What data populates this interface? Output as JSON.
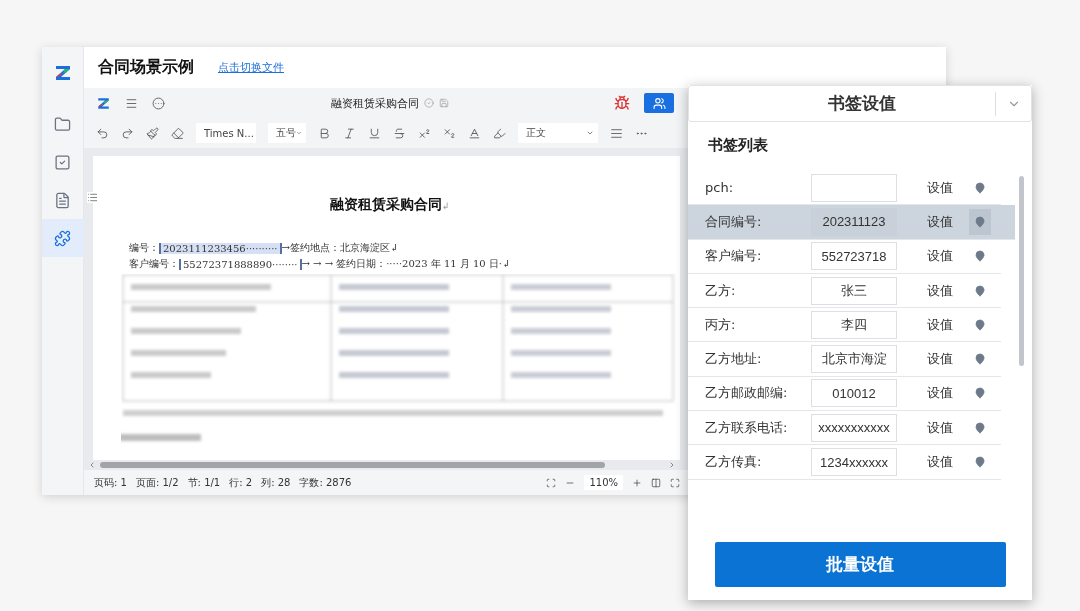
{
  "header": {
    "title": "合同场景示例",
    "link": "点击切换文件"
  },
  "rail": [
    {
      "kind": "folder",
      "selected": false
    },
    {
      "kind": "tasks",
      "selected": false
    },
    {
      "kind": "document",
      "selected": false
    },
    {
      "kind": "plugin",
      "selected": true
    }
  ],
  "editor": {
    "doc_title": "融资租赁采购合同",
    "font": "Times N...",
    "size": "五号",
    "style": "正文"
  },
  "document": {
    "title": "融资租赁采购合同",
    "title_mark": "↲",
    "lines": [
      {
        "label": "编号：",
        "bookmark": "2023111233456··········",
        "selected": true,
        "rest": "→签约地点：北京海淀区↲"
      },
      {
        "label": "客户编号：",
        "bookmark": "55272371888890········",
        "selected": false,
        "rest": "→  →   →  签约日期：·····2023 年 11 月 10 日·↲"
      }
    ]
  },
  "status_bar": [
    "页码: 1",
    "页面: 1/2",
    "节: 1/1",
    "行: 2",
    "列: 28",
    "字数: 2876"
  ],
  "zoom": "110%",
  "panel": {
    "title": "书签设值",
    "list_title": "书签列表",
    "button": "批量设值",
    "rows": [
      {
        "label": "pch:",
        "value": "",
        "action": "设值",
        "selected": false
      },
      {
        "label": "合同编号:",
        "value": "202311123",
        "action": "设值",
        "selected": true
      },
      {
        "label": "客户编号:",
        "value": "552723718",
        "action": "设值",
        "selected": false
      },
      {
        "label": "乙方:",
        "value": "张三",
        "action": "设值",
        "selected": false
      },
      {
        "label": "丙方:",
        "value": "李四",
        "action": "设值",
        "selected": false
      },
      {
        "label": "乙方地址:",
        "value": "北京市海淀",
        "action": "设值",
        "selected": false
      },
      {
        "label": "乙方邮政邮编:",
        "value": "010012",
        "action": "设值",
        "selected": false
      },
      {
        "label": "乙方联系电话:",
        "value": "xxxxxxxxxxx",
        "action": "设值",
        "selected": false
      },
      {
        "label": "乙方传真:",
        "value": "1234xxxxxx",
        "action": "设值",
        "selected": false
      }
    ]
  }
}
